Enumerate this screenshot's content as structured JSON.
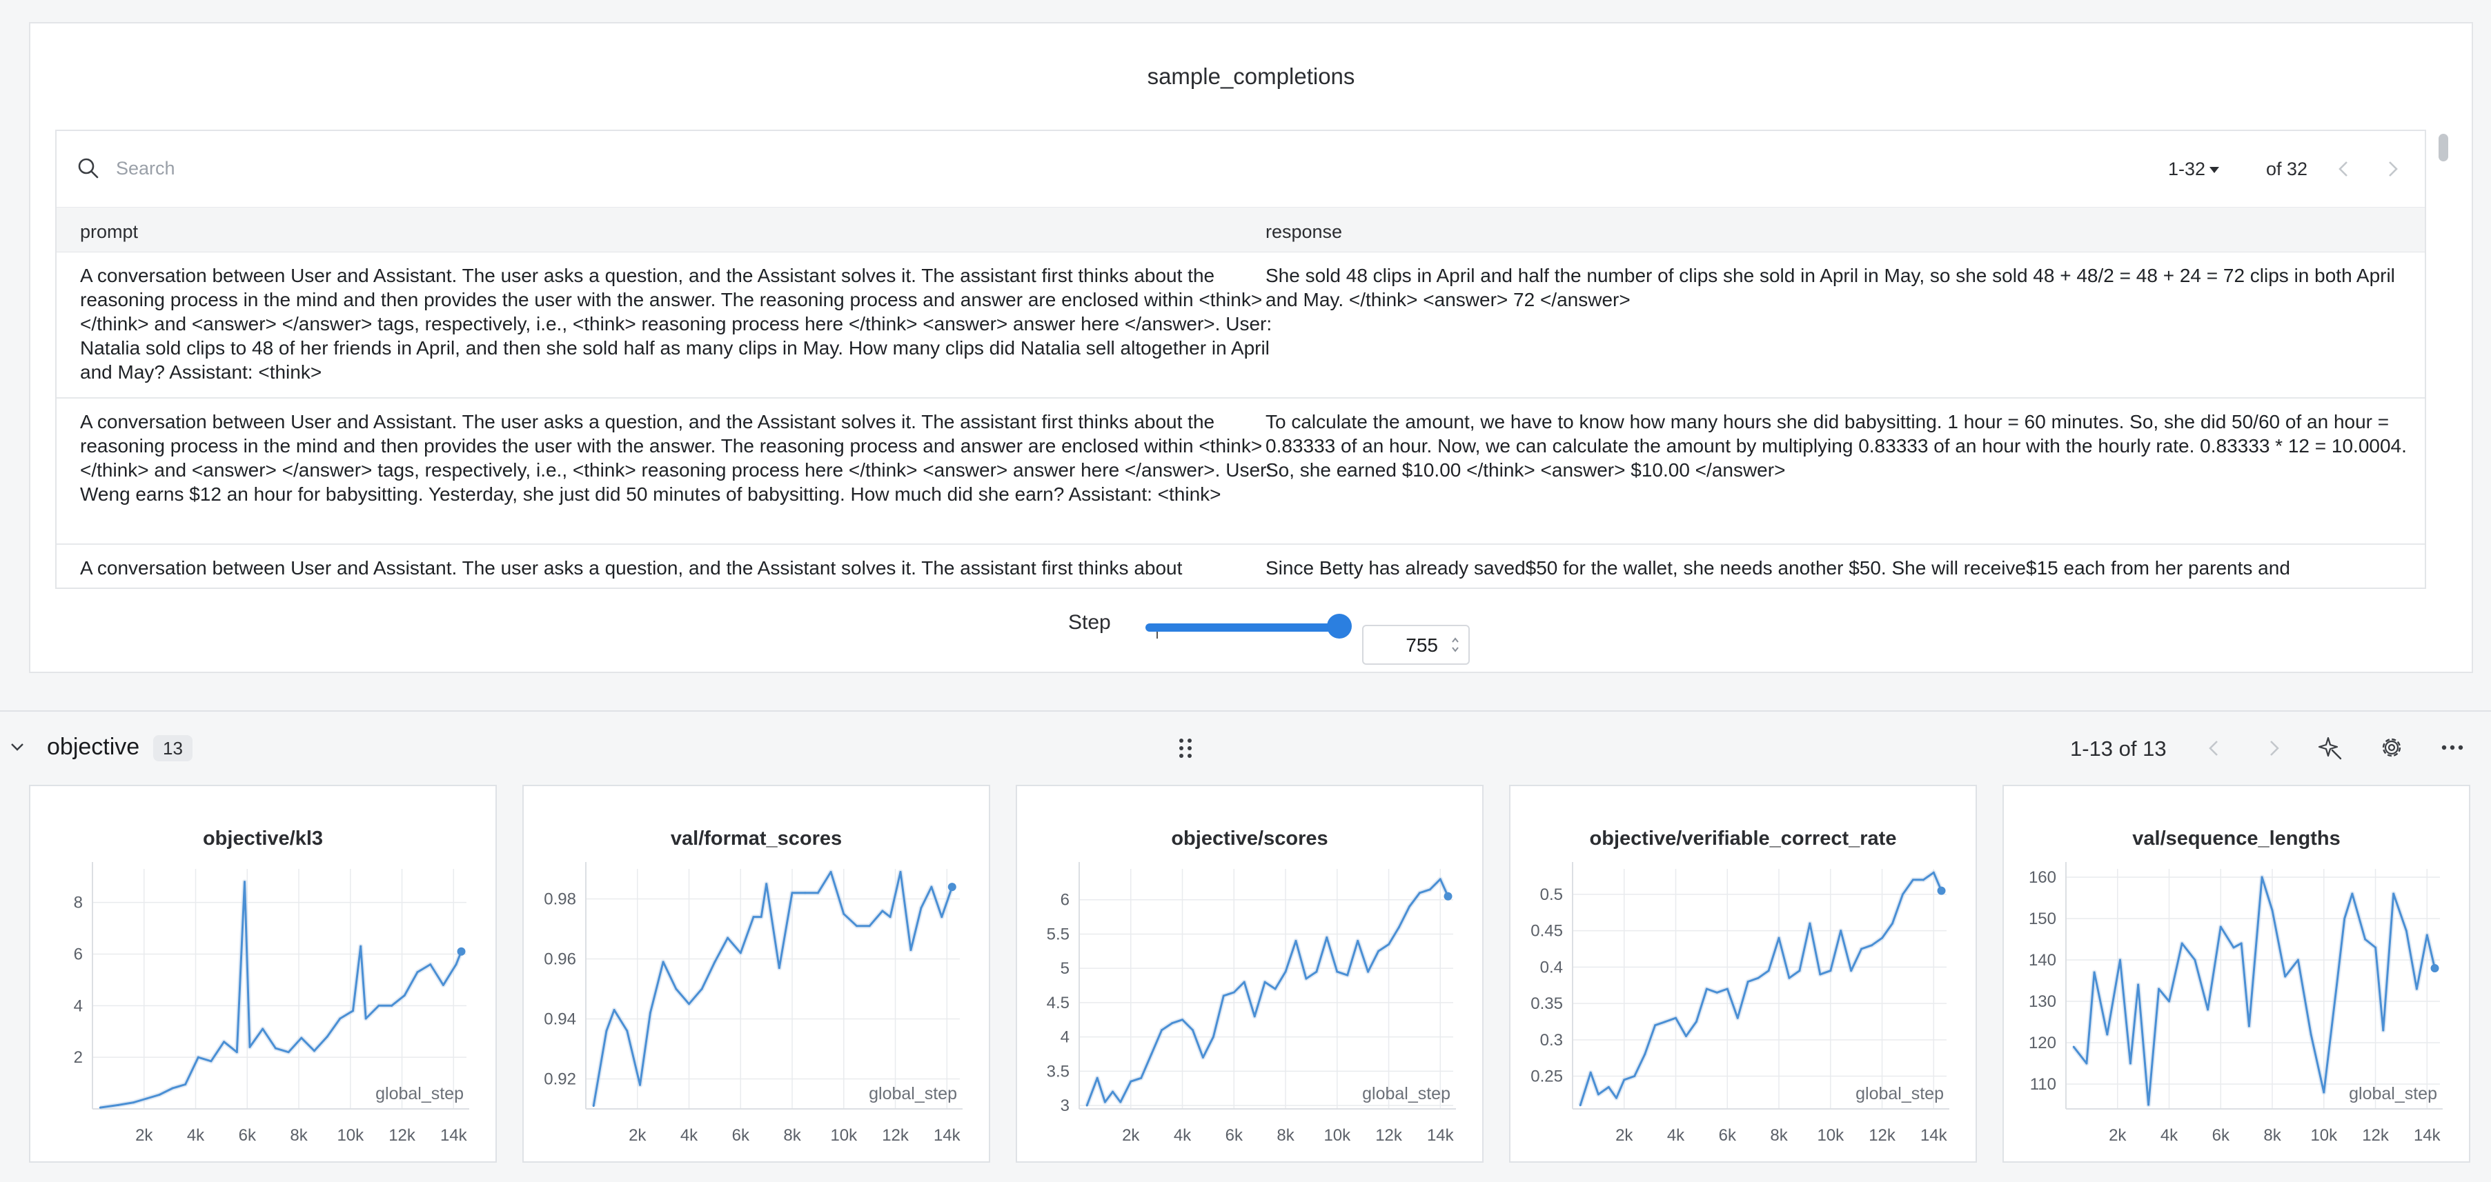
{
  "table_panel": {
    "title": "sample_completions",
    "search_placeholder": "Search",
    "page_range": "1-32",
    "page_of": "of 32",
    "columns": [
      "prompt",
      "response"
    ],
    "rows": [
      {
        "prompt": "A conversation between User and Assistant. The user asks a question, and the Assistant solves it. The assistant first thinks about the reasoning process in the mind and then provides the user with the answer. The reasoning process and answer are enclosed within <think> </think> and <answer> </answer> tags, respectively, i.e., <think> reasoning process here </think> <answer> answer here </answer>. User: Natalia sold clips to 48 of her friends in April, and then she sold half as many clips in May. How many clips did Natalia sell altogether in April and May? Assistant: <think>",
        "response": "She sold 48 clips in April and half the number of clips she sold in April in May, so she sold 48 + 48/2 = 48 + 24 = 72 clips in both April and May. </think> <answer> 72 </answer>"
      },
      {
        "prompt": "A conversation between User and Assistant. The user asks a question, and the Assistant solves it. The assistant first thinks about the reasoning process in the mind and then provides the user with the answer. The reasoning process and answer are enclosed within <think> </think> and <answer> </answer> tags, respectively, i.e., <think> reasoning process here </think> <answer> answer here </answer>. User: Weng earns $12 an hour for babysitting. Yesterday, she just did 50 minutes of babysitting. How much did she earn? Assistant: <think>",
        "response": "To calculate the amount, we have to know how many hours she did babysitting. 1 hour = 60 minutes. So, she did 50/60 of an hour = 0.83333 of an hour. Now, we can calculate the amount by multiplying 0.83333 of an hour with the hourly rate. 0.83333 * 12 = 10.0004. So, she earned $10.00 </think> <answer> $10.00 </answer>"
      },
      {
        "prompt": "A conversation between User and Assistant. The user asks a question, and the Assistant solves it. The assistant first thinks about",
        "response": "Since Betty has already saved$50 for the wallet, she needs another $50. She will receive$15 each from her parents and"
      }
    ],
    "step_label": "Step",
    "step_value": "755",
    "step_fraction": 0.99
  },
  "section": {
    "title": "objective",
    "count": "13",
    "pager": "1-13 of 13",
    "icons": [
      "chevron-down-icon",
      "drag-handle-icon",
      "chevron-left-icon",
      "chevron-right-icon",
      "sparkle-icon",
      "gear-icon",
      "more-icon"
    ]
  },
  "colors": {
    "accent": "#2b7fe0",
    "line": "#4a8fd4",
    "band": "#c8d8ec"
  },
  "chart_data": [
    {
      "type": "line",
      "title": "objective/kl3",
      "xlabel": "global_step",
      "x_ticks": [
        "2k",
        "4k",
        "6k",
        "8k",
        "10k",
        "12k",
        "14k"
      ],
      "y_ticks": [
        "2",
        "4",
        "6",
        "8"
      ],
      "xlim": [
        0,
        14500
      ],
      "ylim": [
        0,
        9.3
      ],
      "series": [
        {
          "x": [
            300,
            1000,
            1600,
            2100,
            2600,
            3100,
            3600,
            4100,
            4600,
            5100,
            5600,
            5900,
            6100,
            6600,
            7100,
            7600,
            8100,
            8600,
            9100,
            9600,
            10100,
            10400,
            10600,
            11100,
            11600,
            12100,
            12600,
            13100,
            13600,
            14100,
            14300
          ],
          "y": [
            0.05,
            0.15,
            0.25,
            0.4,
            0.55,
            0.8,
            0.95,
            2.0,
            1.85,
            2.6,
            2.2,
            8.8,
            2.4,
            3.1,
            2.35,
            2.2,
            2.75,
            2.25,
            2.8,
            3.5,
            3.8,
            6.3,
            3.5,
            4.0,
            4.0,
            4.4,
            5.3,
            5.6,
            4.8,
            5.6,
            6.1
          ]
        }
      ]
    },
    {
      "type": "line",
      "title": "val/format_scores",
      "xlabel": "global_step",
      "x_ticks": [
        "2k",
        "4k",
        "6k",
        "8k",
        "10k",
        "12k",
        "14k"
      ],
      "y_ticks": [
        "0.92",
        "0.94",
        "0.96",
        "0.98"
      ],
      "xlim": [
        0,
        14500
      ],
      "ylim": [
        0.91,
        0.99
      ],
      "series": [
        {
          "x": [
            300,
            800,
            1100,
            1600,
            2100,
            2500,
            3000,
            3500,
            4000,
            4500,
            5000,
            5500,
            6000,
            6500,
            6800,
            7000,
            7500,
            8000,
            8500,
            9000,
            9500,
            10000,
            10500,
            11000,
            11500,
            11800,
            12200,
            12600,
            13000,
            13400,
            13800,
            14200
          ],
          "y": [
            0.911,
            0.936,
            0.943,
            0.936,
            0.918,
            0.942,
            0.959,
            0.95,
            0.945,
            0.95,
            0.959,
            0.967,
            0.962,
            0.974,
            0.974,
            0.985,
            0.957,
            0.982,
            0.982,
            0.982,
            0.989,
            0.975,
            0.971,
            0.971,
            0.976,
            0.974,
            0.989,
            0.963,
            0.977,
            0.984,
            0.974,
            0.984
          ]
        }
      ]
    },
    {
      "type": "line",
      "title": "objective/scores",
      "xlabel": "global_step",
      "x_ticks": [
        "2k",
        "4k",
        "6k",
        "8k",
        "10k",
        "12k",
        "14k"
      ],
      "y_ticks": [
        "3",
        "3.5",
        "4",
        "4.5",
        "5",
        "5.5",
        "6"
      ],
      "xlim": [
        0,
        14500
      ],
      "ylim": [
        2.95,
        6.45
      ],
      "series": [
        {
          "x": [
            300,
            700,
            1000,
            1300,
            1600,
            2000,
            2400,
            2800,
            3200,
            3600,
            4000,
            4400,
            4800,
            5200,
            5600,
            6000,
            6400,
            6800,
            7200,
            7600,
            8000,
            8400,
            8800,
            9200,
            9600,
            10000,
            10400,
            10800,
            11200,
            11600,
            12000,
            12400,
            12800,
            13200,
            13600,
            14000,
            14300
          ],
          "y": [
            3.0,
            3.4,
            3.05,
            3.2,
            3.05,
            3.35,
            3.4,
            3.75,
            4.1,
            4.2,
            4.25,
            4.1,
            3.7,
            4.0,
            4.6,
            4.65,
            4.8,
            4.3,
            4.8,
            4.7,
            4.95,
            5.4,
            4.85,
            4.95,
            5.45,
            4.95,
            4.9,
            5.4,
            4.95,
            5.25,
            5.35,
            5.6,
            5.9,
            6.1,
            6.15,
            6.3,
            6.05
          ]
        }
      ]
    },
    {
      "type": "line",
      "title": "objective/verifiable_correct_rate",
      "xlabel": "global_step",
      "x_ticks": [
        "2k",
        "4k",
        "6k",
        "8k",
        "10k",
        "12k",
        "14k"
      ],
      "y_ticks": [
        "0.25",
        "0.3",
        "0.35",
        "0.4",
        "0.45",
        "0.5"
      ],
      "xlim": [
        0,
        14500
      ],
      "ylim": [
        0.205,
        0.535
      ],
      "series": [
        {
          "x": [
            300,
            700,
            1000,
            1400,
            1700,
            2000,
            2400,
            2800,
            3200,
            3600,
            4000,
            4400,
            4800,
            5200,
            5600,
            6000,
            6400,
            6800,
            7200,
            7600,
            8000,
            8400,
            8800,
            9200,
            9600,
            10000,
            10400,
            10800,
            11200,
            11600,
            12000,
            12400,
            12800,
            13200,
            13600,
            14000,
            14300
          ],
          "y": [
            0.21,
            0.255,
            0.225,
            0.235,
            0.22,
            0.245,
            0.25,
            0.28,
            0.32,
            0.325,
            0.33,
            0.305,
            0.325,
            0.37,
            0.365,
            0.37,
            0.33,
            0.38,
            0.385,
            0.395,
            0.44,
            0.385,
            0.395,
            0.46,
            0.39,
            0.395,
            0.45,
            0.395,
            0.425,
            0.43,
            0.44,
            0.46,
            0.5,
            0.52,
            0.52,
            0.53,
            0.505
          ]
        }
      ]
    },
    {
      "type": "line",
      "title": "val/sequence_lengths",
      "xlabel": "global_step",
      "x_ticks": [
        "2k",
        "4k",
        "6k",
        "8k",
        "10k",
        "12k",
        "14k"
      ],
      "y_ticks": [
        "110",
        "120",
        "130",
        "140",
        "150",
        "160"
      ],
      "xlim": [
        0,
        14500
      ],
      "ylim": [
        104,
        162
      ],
      "series": [
        {
          "x": [
            300,
            800,
            1100,
            1600,
            2100,
            2500,
            2800,
            3200,
            3600,
            4000,
            4500,
            5000,
            5500,
            6000,
            6500,
            6800,
            7100,
            7600,
            8000,
            8500,
            9000,
            9500,
            10000,
            10500,
            10800,
            11100,
            11600,
            12000,
            12300,
            12700,
            13200,
            13600,
            14000,
            14300
          ],
          "y": [
            119,
            115,
            137,
            122,
            140,
            115,
            134,
            105,
            133,
            130,
            144,
            140,
            128,
            148,
            143,
            144,
            124,
            160,
            152,
            136,
            140,
            122,
            108,
            134,
            150,
            156,
            145,
            143,
            123,
            156,
            147,
            133,
            146,
            138
          ]
        }
      ]
    }
  ]
}
